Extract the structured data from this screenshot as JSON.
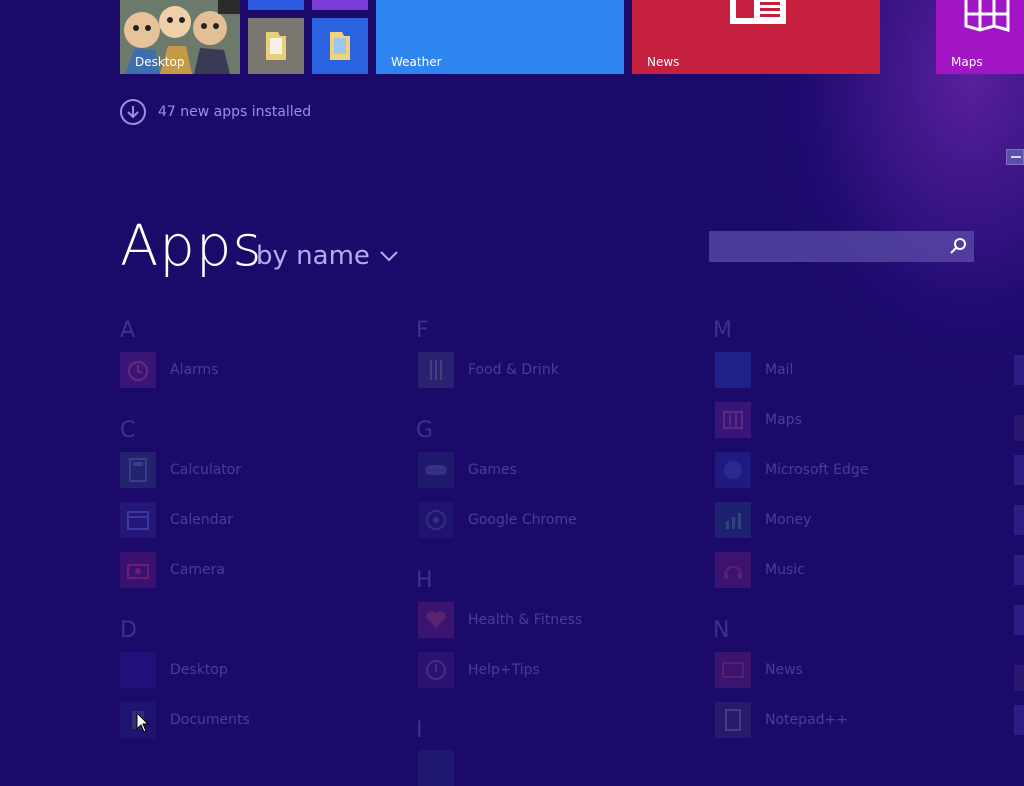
{
  "tiles": {
    "desktop": "Desktop",
    "weather": "Weather",
    "news": "News",
    "maps": "Maps"
  },
  "notification": "47 new apps installed",
  "header": {
    "title": "Apps",
    "sort": "by name"
  },
  "search": {
    "placeholder": ""
  },
  "groups": [
    {
      "letter": "A",
      "apps": [
        "Alarms"
      ]
    },
    {
      "letter": "C",
      "apps": [
        "Calculator",
        "Calendar",
        "Camera"
      ]
    },
    {
      "letter": "D",
      "apps": [
        "Desktop",
        "Documents"
      ]
    },
    {
      "letter": "F",
      "apps": [
        "Food & Drink"
      ]
    },
    {
      "letter": "G",
      "apps": [
        "Games",
        "Google Chrome"
      ]
    },
    {
      "letter": "H",
      "apps": [
        "Health & Fitness",
        "Help+Tips"
      ]
    },
    {
      "letter": "I",
      "apps": []
    },
    {
      "letter": "M",
      "apps": [
        "Mail",
        "Maps",
        "Microsoft Edge",
        "Money",
        "Music"
      ]
    },
    {
      "letter": "N",
      "apps": [
        "News",
        "Notepad++"
      ]
    }
  ],
  "colors": {
    "background": "#1b0a6a",
    "weather_tile": "#2f85f0",
    "news_tile": "#c5213e",
    "maps_tile": "#a215c5"
  }
}
